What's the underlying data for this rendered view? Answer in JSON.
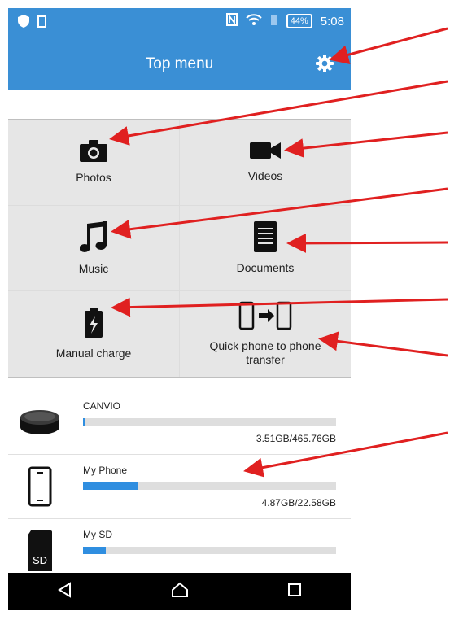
{
  "status_bar": {
    "battery_text": "44%",
    "time": "5:08"
  },
  "header": {
    "title": "Top menu"
  },
  "menu": {
    "tiles": [
      {
        "label": "Photos",
        "icon": "camera-icon"
      },
      {
        "label": "Videos",
        "icon": "video-camera-icon"
      },
      {
        "label": "Music",
        "icon": "music-note-icon"
      },
      {
        "label": "Documents",
        "icon": "document-icon"
      },
      {
        "label": "Manual charge",
        "icon": "battery-charge-icon"
      },
      {
        "label": "Quick phone to phone transfer",
        "icon": "phone-transfer-icon"
      }
    ]
  },
  "storage": [
    {
      "name": "CANVIO",
      "size": "3.51GB/465.76GB",
      "usage_fraction": 0.008,
      "icon": "external-drive-icon"
    },
    {
      "name": "My Phone",
      "size": "4.87GB/22.58GB",
      "usage_fraction": 0.22,
      "icon": "phone-icon"
    },
    {
      "name": "My SD",
      "size": "",
      "usage_fraction": 0.09,
      "icon": "sd-card-icon"
    }
  ],
  "colors": {
    "accent": "#3a8fd5",
    "bar_fill": "#2f8ee0",
    "annotation_arrows": "#e02020"
  }
}
